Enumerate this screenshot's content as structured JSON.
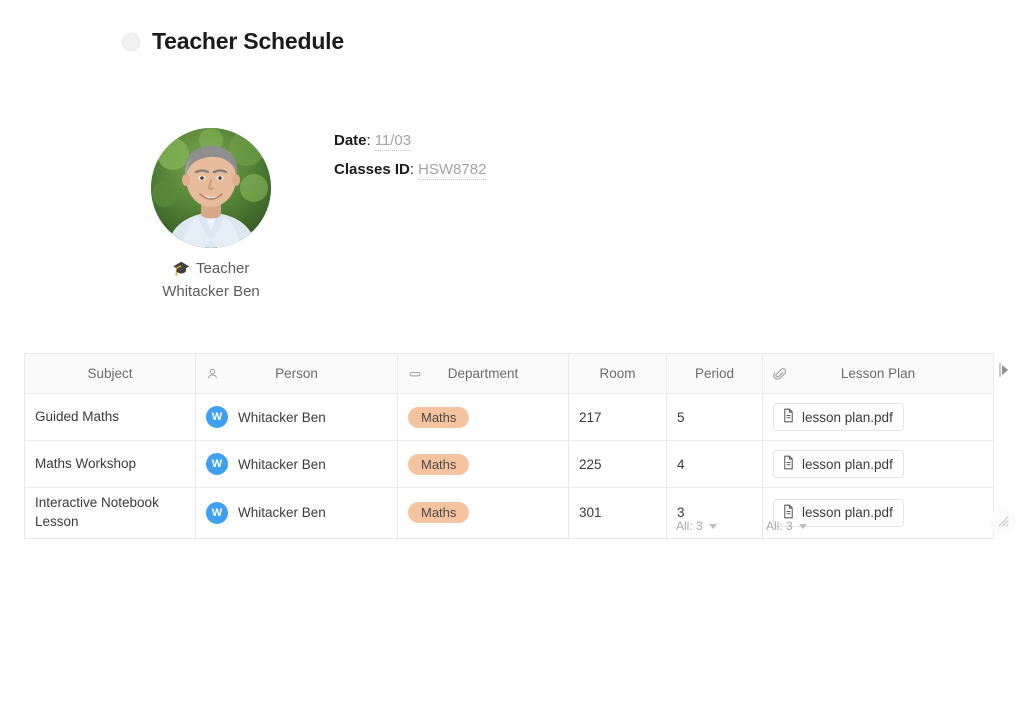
{
  "page": {
    "title": "Teacher Schedule",
    "bullet_icon": "circle-placeholder-icon"
  },
  "profile": {
    "photo_alt": "teacher-portrait",
    "role_icon": "graduation-cap-icon",
    "role": "Teacher",
    "name": "Whitacker Ben"
  },
  "meta": {
    "date": {
      "label": "Date",
      "separator": ":",
      "value": "11/03"
    },
    "classes_id": {
      "label": "Classes ID",
      "separator": ":",
      "value": "HSW8782"
    }
  },
  "table": {
    "columns": [
      {
        "label": "Subject",
        "icon": null
      },
      {
        "label": "Person",
        "icon": "person-icon"
      },
      {
        "label": "Department",
        "icon": "tag-icon"
      },
      {
        "label": "Room",
        "icon": null
      },
      {
        "label": "Period",
        "icon": null
      },
      {
        "label": "Lesson Plan",
        "icon": "paperclip-icon"
      }
    ],
    "rows": [
      {
        "subject": "Guided Maths",
        "person": {
          "initial": "W",
          "name": "Whitacker Ben"
        },
        "department": "Maths",
        "room": "217",
        "period": "5",
        "lesson_plan": "lesson plan.pdf"
      },
      {
        "subject": "Maths Workshop",
        "person": {
          "initial": "W",
          "name": "Whitacker Ben"
        },
        "department": "Maths",
        "room": "225",
        "period": "4",
        "lesson_plan": "lesson plan.pdf"
      },
      {
        "subject": "Interactive Notebook Lesson",
        "person": {
          "initial": "W",
          "name": "Whitacker Ben"
        },
        "department": "Maths",
        "room": "301",
        "period": "3",
        "lesson_plan": "lesson plan.pdf"
      }
    ],
    "summary": {
      "room_total": "All: 3",
      "period_total": "All: 3"
    }
  },
  "colors": {
    "person_avatar": "#3fa0f0",
    "department_tag": "#f6c3a0",
    "header_background": "#fafafa",
    "border": "#e9e9e9"
  }
}
